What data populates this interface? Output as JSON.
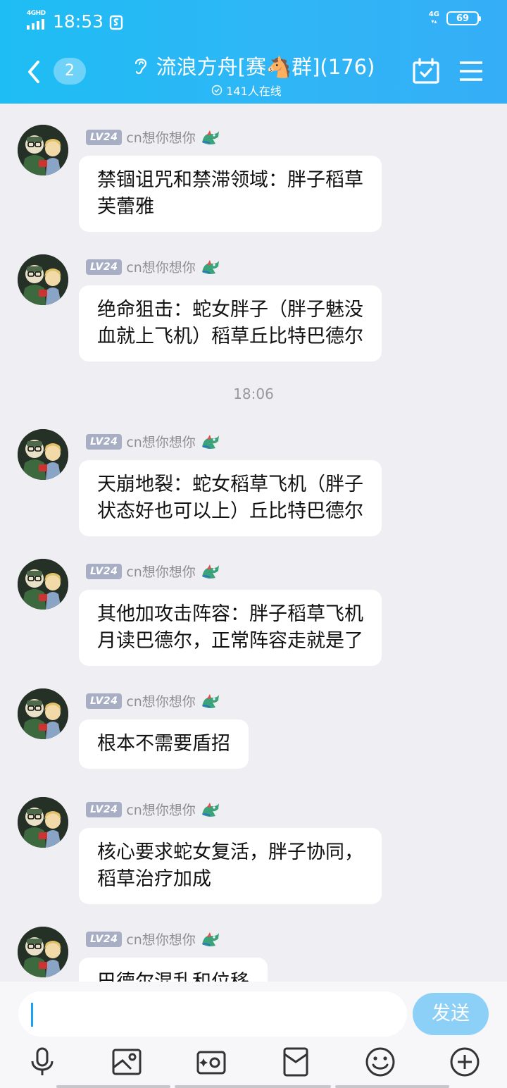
{
  "status_bar": {
    "network": "4GHD",
    "time": "18:53",
    "right_network": "4G",
    "battery": "69"
  },
  "header": {
    "unread_count": "2",
    "title": "流浪方舟[赛🐴群](176)",
    "online": "141人在线"
  },
  "colors": {
    "header_bg": "#2fb6f6",
    "chat_bg": "#efeff3",
    "send_button": "#8dd0f7",
    "level_badge": "#a8aec4"
  },
  "messages": [
    {
      "level": "LV24",
      "name": "cn想你想你",
      "lines": [
        "禁锢诅咒和禁滞领域：胖子稻草",
        "芙蕾雅"
      ]
    },
    {
      "level": "LV24",
      "name": "cn想你想你",
      "lines": [
        "绝命狙击：蛇女胖子（胖子魅没",
        "血就上飞机）稻草丘比特巴德尔"
      ]
    },
    {
      "level": "LV24",
      "name": "cn想你想你",
      "lines": [
        "天崩地裂：蛇女稻草飞机（胖子",
        "状态好也可以上）丘比特巴德尔"
      ]
    },
    {
      "level": "LV24",
      "name": "cn想你想你",
      "lines": [
        "其他加攻击阵容：胖子稻草飞机",
        "月读巴德尔，正常阵容走就是了"
      ]
    },
    {
      "level": "LV24",
      "name": "cn想你想你",
      "lines": [
        "根本不需要盾招"
      ]
    },
    {
      "level": "LV24",
      "name": "cn想你想你",
      "lines": [
        "核心要求蛇女复活，胖子协同，",
        "稻草治疗加成"
      ]
    },
    {
      "level": "LV24",
      "name": "cn想你想你",
      "lines": [
        "巴德尔混乱和位移"
      ]
    }
  ],
  "timestamp": "18:06",
  "input": {
    "value": "",
    "send_label": "发送"
  },
  "toolbar": [
    "mic-icon",
    "photo-icon",
    "camera-icon",
    "red-packet-icon",
    "emoji-icon",
    "plus-icon"
  ]
}
